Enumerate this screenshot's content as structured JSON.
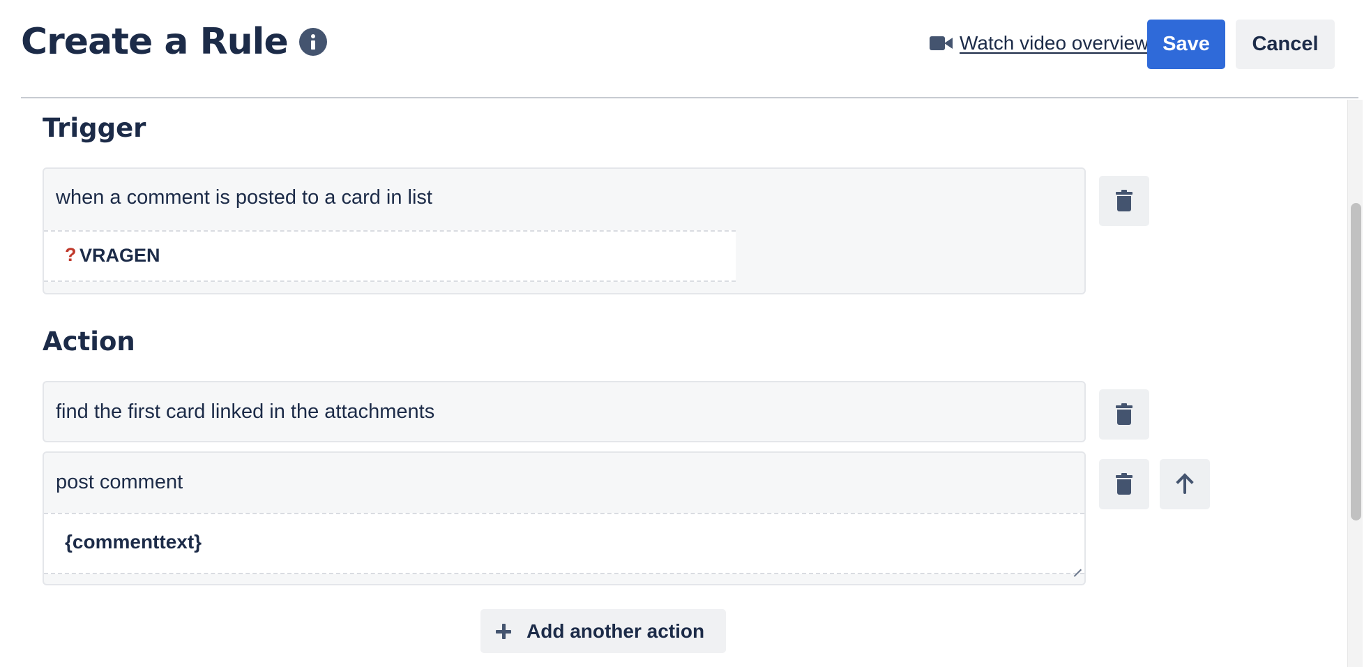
{
  "header": {
    "title": "Create a Rule",
    "info_icon": "info-icon",
    "video_link": "Watch video overview",
    "video_icon": "video-camera-icon",
    "save_label": "Save",
    "cancel_label": "Cancel"
  },
  "trigger": {
    "heading": "Trigger",
    "text": "when a comment is posted to a card in list",
    "list_marker": "?",
    "list_name": "VRAGEN"
  },
  "action": {
    "heading": "Action",
    "items": [
      {
        "text": "find the first card linked in the attachments"
      },
      {
        "text": "post comment",
        "value": "{commenttext}"
      }
    ],
    "add_label": "Add another action"
  },
  "colors": {
    "primary": "#2f6ad9",
    "text": "#1c2b48",
    "icon": "#44546f",
    "block_bg": "#f6f7f8",
    "marker": "#c0392b"
  }
}
